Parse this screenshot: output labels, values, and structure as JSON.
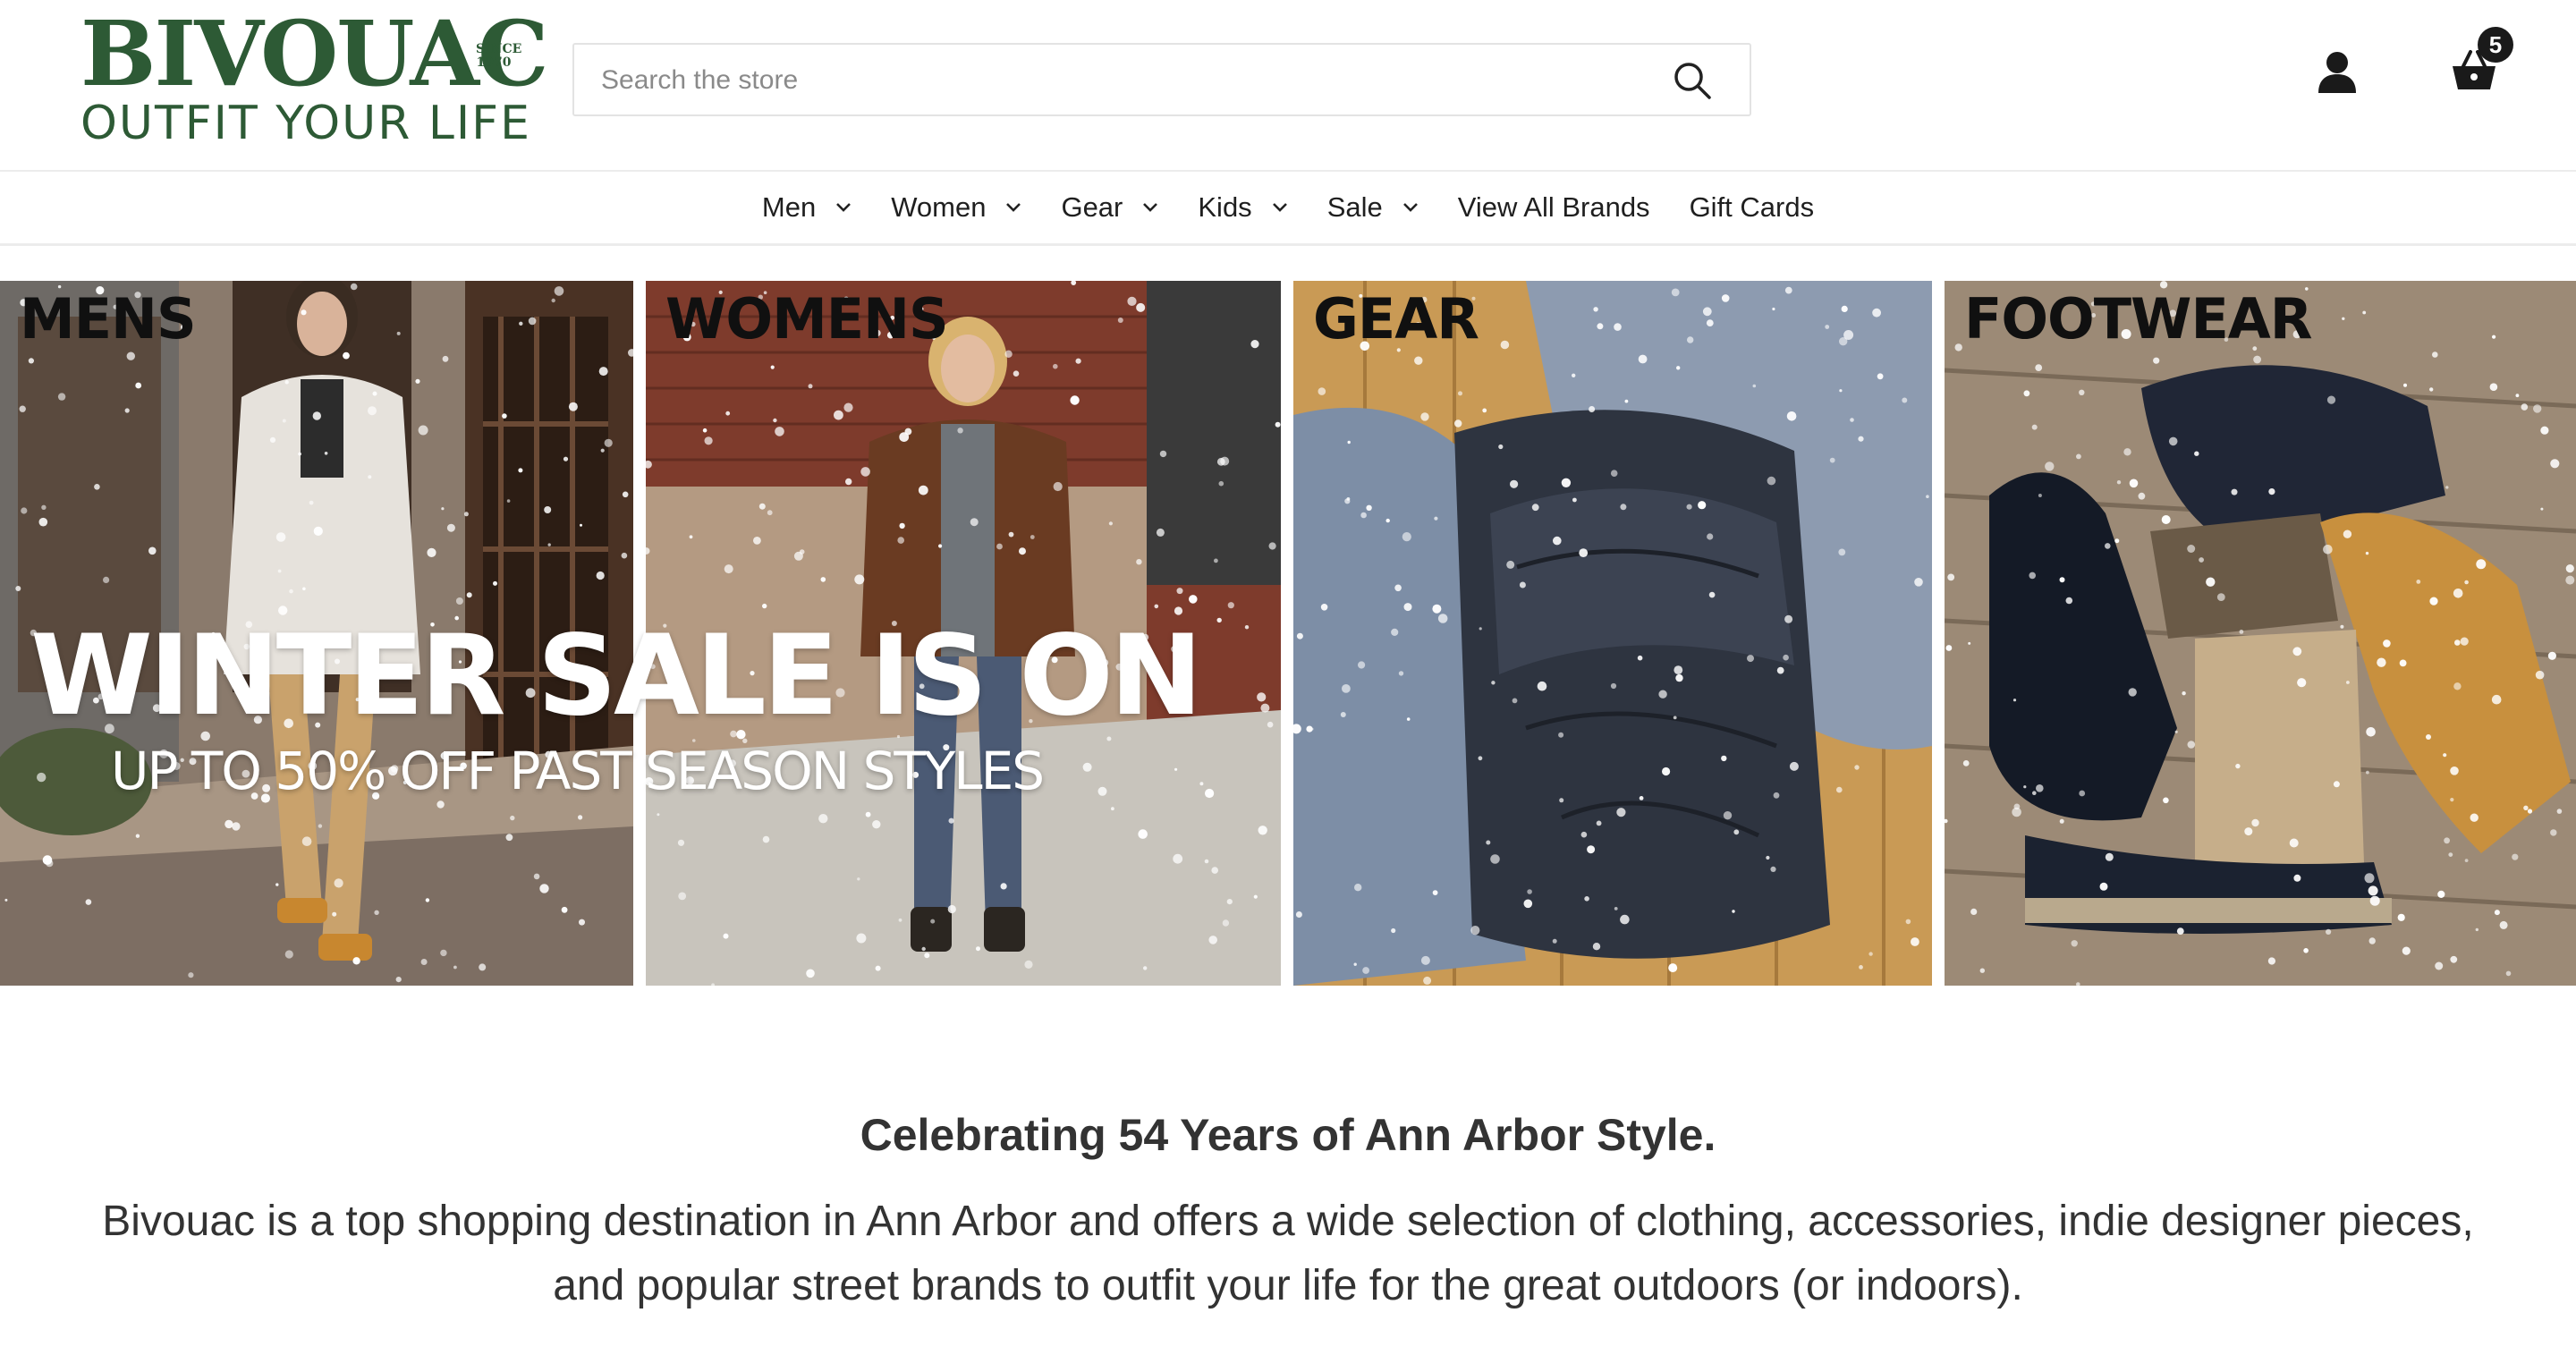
{
  "header": {
    "logo": {
      "name": "BIVOUAC",
      "since": "SINCE 1970",
      "tagline": "OUTFIT YOUR LIFE"
    },
    "search": {
      "placeholder": "Search the store",
      "value": ""
    },
    "cart": {
      "count": "5"
    }
  },
  "nav": {
    "items": [
      {
        "label": "Men",
        "has_dropdown": true
      },
      {
        "label": "Women",
        "has_dropdown": true
      },
      {
        "label": "Gear",
        "has_dropdown": true
      },
      {
        "label": "Kids",
        "has_dropdown": true
      },
      {
        "label": "Sale",
        "has_dropdown": true
      },
      {
        "label": "View All Brands",
        "has_dropdown": false
      },
      {
        "label": "Gift Cards",
        "has_dropdown": false
      }
    ]
  },
  "hero": {
    "tiles": [
      {
        "label": "MENS"
      },
      {
        "label": "WOMENS"
      },
      {
        "label": "GEAR"
      },
      {
        "label": "FOOTWEAR"
      }
    ],
    "headline": "WINTER SALE IS ON",
    "subheadline": "UP TO 50% OFF PAST SEASON STYLES"
  },
  "about": {
    "title": "Celebrating 54 Years of Ann Arbor Style.",
    "body": "Bivouac is a top shopping destination in Ann Arbor and offers a wide selection of clothing, accessories, indie designer pieces, and popular street brands to outfit your life for the great outdoors (or indoors)."
  },
  "colors": {
    "brand_green": "#2d5a35",
    "text": "#333333",
    "badge": "#1a1a1a"
  },
  "icons": [
    "search-icon",
    "user-icon",
    "basket-icon",
    "chevron-down-icon"
  ]
}
